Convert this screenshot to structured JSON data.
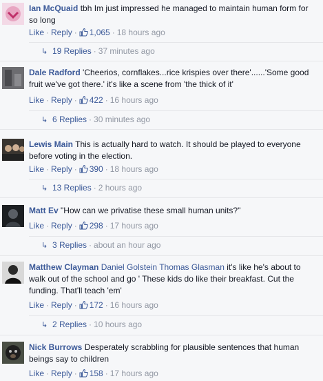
{
  "comments": [
    {
      "author": "Ian McQuaid",
      "mentions": "",
      "text": "tbh Im just impressed he managed to maintain human form for so long",
      "like_label": "Like",
      "reply_label": "Reply",
      "likes": "1,065",
      "time": "18 hours ago",
      "replies_label": "19 Replies",
      "replies_time": "37 minutes ago"
    },
    {
      "author": "Dale Radford",
      "mentions": "",
      "text": "'Cheerios, cornflakes...rice krispies over there'......'Some good fruit we've got there.' it's like a scene from 'the thick of it'",
      "like_label": "Like",
      "reply_label": "Reply",
      "likes": "422",
      "time": "16 hours ago",
      "replies_label": "6 Replies",
      "replies_time": "30 minutes ago"
    },
    {
      "author": "Lewis Main",
      "mentions": "",
      "text": "This is actually hard to watch. It should be played to everyone before voting in the election.",
      "like_label": "Like",
      "reply_label": "Reply",
      "likes": "390",
      "time": "18 hours ago",
      "replies_label": "13 Replies",
      "replies_time": "2 hours ago"
    },
    {
      "author": "Matt Ev",
      "mentions": "",
      "text": "\"How can we privatise these small human units?\"",
      "like_label": "Like",
      "reply_label": "Reply",
      "likes": "298",
      "time": "17 hours ago",
      "replies_label": "3 Replies",
      "replies_time": "about an hour ago"
    },
    {
      "author": "Matthew Clayman",
      "mentions": "Daniel Golstein Thomas Glasman",
      "text": "it's like he's about to walk out of the school and go ' These kids do like their breakfast. Cut the funding. That'll teach 'em'",
      "like_label": "Like",
      "reply_label": "Reply",
      "likes": "172",
      "time": "16 hours ago",
      "replies_label": "2 Replies",
      "replies_time": "10 hours ago"
    },
    {
      "author": "Nick Burrows",
      "mentions": "",
      "text": "Desperately scrabbling for plausible sentences that human beings say to children",
      "like_label": "Like",
      "reply_label": "Reply",
      "likes": "158",
      "time": "17 hours ago"
    }
  ],
  "icons": {
    "like": "thumbs-up-icon",
    "reply_arrow": "reply-arrow-icon"
  },
  "colors": {
    "link": "#3b5998",
    "meta": "#9197a3",
    "background": "#f6f7f9"
  }
}
